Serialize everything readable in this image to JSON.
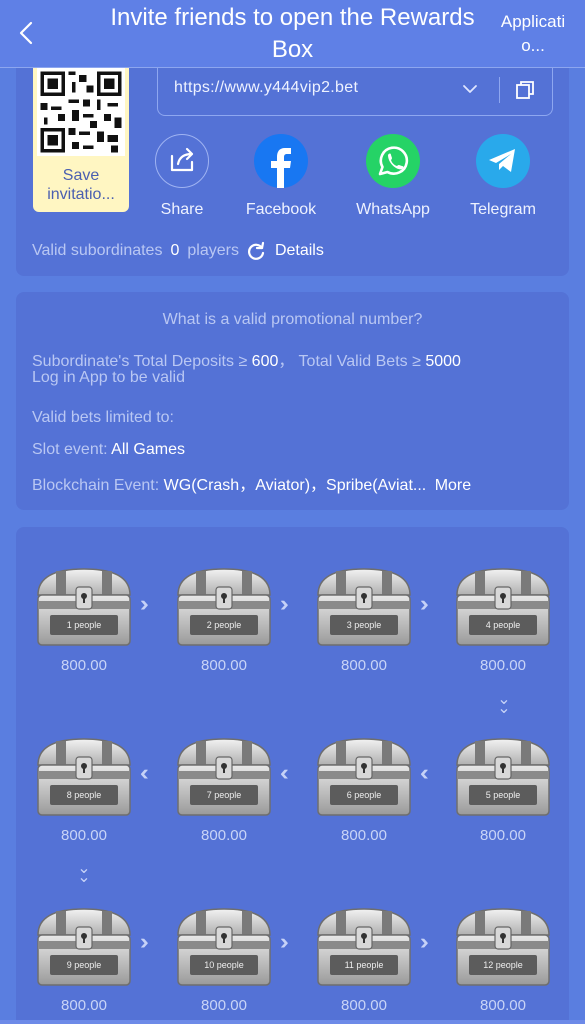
{
  "header": {
    "title": "Invite friends to open the Rewards Box",
    "app_link": "Applicati o..."
  },
  "invite": {
    "qr_label": "Save invitatio...",
    "url": "https://www.y444vip2.bet",
    "share": [
      {
        "label": "Share",
        "icon": "share-icon",
        "color": "#5472d6"
      },
      {
        "label": "Facebook",
        "icon": "facebook-icon",
        "color": "#1877f2"
      },
      {
        "label": "WhatsApp",
        "icon": "whatsapp-icon",
        "color": "#25d366"
      },
      {
        "label": "Telegram",
        "icon": "telegram-icon",
        "color": "#29a9eb"
      }
    ],
    "valid_label": "Valid subordinates",
    "valid_count": "0",
    "valid_unit": "players",
    "details": "Details"
  },
  "rules": {
    "title": "What is a valid promotional number?",
    "deposits_label": "Subordinate's Total Deposits ≥",
    "deposits_value": "600",
    "bets_label": "Total Valid Bets ≥",
    "bets_value": "5000",
    "login": "Log in App to be valid",
    "limited": "Valid bets limited to:",
    "slot_label": "Slot event:",
    "slot_value": "All Games",
    "chain_label": "Blockchain Event:",
    "chain_value": "WG(Crash，Aviator)，Spribe(Aviat...",
    "more": "More"
  },
  "chests": [
    {
      "people": "1 people",
      "amount": "800.00"
    },
    {
      "people": "2 people",
      "amount": "800.00"
    },
    {
      "people": "3 people",
      "amount": "800.00"
    },
    {
      "people": "4 people",
      "amount": "800.00"
    },
    {
      "people": "5 people",
      "amount": "800.00"
    },
    {
      "people": "6 people",
      "amount": "800.00"
    },
    {
      "people": "7 people",
      "amount": "800.00"
    },
    {
      "people": "8 people",
      "amount": "800.00"
    },
    {
      "people": "9 people",
      "amount": "800.00"
    },
    {
      "people": "10 people",
      "amount": "800.00"
    },
    {
      "people": "11 people",
      "amount": "800.00"
    },
    {
      "people": "12 people",
      "amount": "800.00"
    }
  ]
}
